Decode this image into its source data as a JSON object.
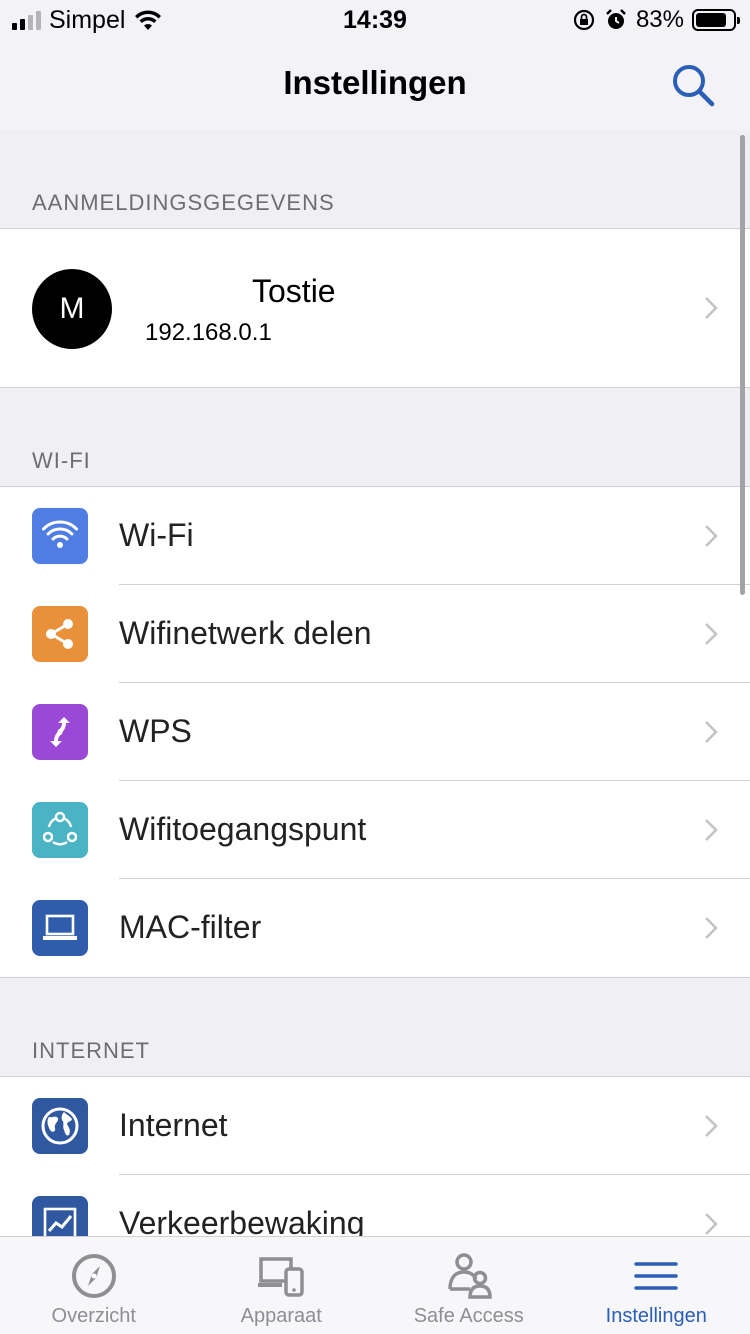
{
  "status_bar": {
    "carrier": "Simpel",
    "time": "14:39",
    "battery_percent": "83%",
    "battery_level": 0.83
  },
  "nav": {
    "title": "Instellingen",
    "search_icon": "search-icon"
  },
  "sections": {
    "account": {
      "header": "AANMELDINGSGEGEVENS",
      "avatar_letter": "M",
      "name": "Tostie",
      "ip": "192.168.0.1"
    },
    "wifi": {
      "header": "WI-FI",
      "items": [
        {
          "label": "Wi-Fi",
          "icon": "wifi-icon",
          "color": "#4f7de2"
        },
        {
          "label": "Wifinetwerk delen",
          "icon": "share-icon",
          "color": "#e8913a"
        },
        {
          "label": "WPS",
          "icon": "wps-icon",
          "color": "#9b48d6"
        },
        {
          "label": "Wifitoegangspunt",
          "icon": "access-point-icon",
          "color": "#4ab3c4"
        },
        {
          "label": "MAC-filter",
          "icon": "laptop-icon",
          "color": "#2f5dab"
        }
      ]
    },
    "internet": {
      "header": "INTERNET",
      "items": [
        {
          "label": "Internet",
          "icon": "globe-icon",
          "color": "#3058a0"
        },
        {
          "label": "Verkeerbewaking",
          "icon": "traffic-chart-icon",
          "color": "#3058a0"
        }
      ]
    }
  },
  "tab_bar": {
    "tabs": [
      {
        "label": "Overzicht",
        "icon": "compass-icon"
      },
      {
        "label": "Apparaat",
        "icon": "devices-icon"
      },
      {
        "label": "Safe Access",
        "icon": "family-icon"
      },
      {
        "label": "Instellingen",
        "icon": "menu-icon"
      }
    ],
    "active": "Instellingen"
  },
  "colors": {
    "accent": "#2b5fb7",
    "inactive": "#8e8e93",
    "background": "#efeff4"
  }
}
